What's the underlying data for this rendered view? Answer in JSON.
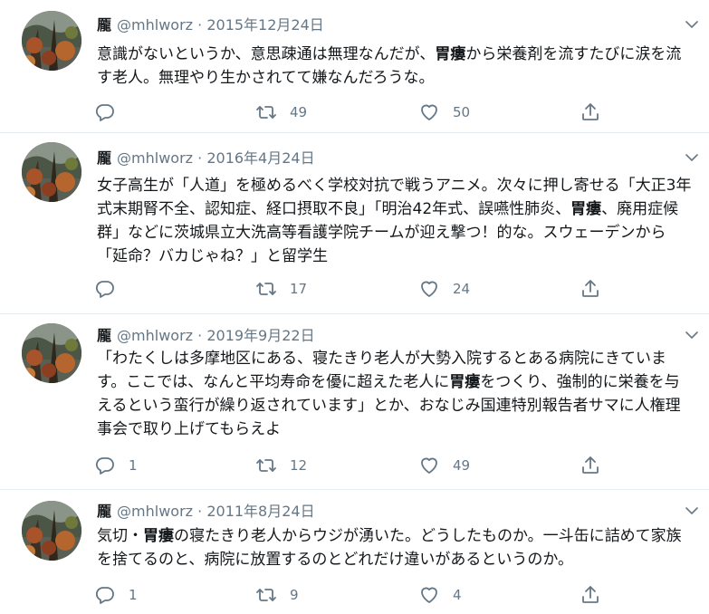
{
  "tweets": [
    {
      "name": "龎",
      "handle": "@mhlworz",
      "date": "2015年12月24日",
      "text_parts": [
        "意識がないというか、意思疎通は無理なんだが、",
        "胃瘻",
        "から栄養剤を流すたびに涙を流す老人。無理やり生かされてて嫌なんだろうな。"
      ],
      "replies": "",
      "retweets": "49",
      "likes": "50"
    },
    {
      "name": "龎",
      "handle": "@mhlworz",
      "date": "2016年4月24日",
      "text_parts": [
        "女子高生が「人道」を極めるべく学校対抗で戦うアニメ。次々に押し寄せる「大正3年式末期腎不全、認知症、経口摂取不良」「明治42年式、誤嚥性肺炎、",
        "胃瘻",
        "、廃用症候群」などに茨城県立大洗高等看護学院チームが迎え撃つ！的な。スウェーデンから「延命？バカじゃね？」と留学生"
      ],
      "replies": "",
      "retweets": "17",
      "likes": "24"
    },
    {
      "name": "龎",
      "handle": "@mhlworz",
      "date": "2019年9月22日",
      "text_parts": [
        "「わたくしは多摩地区にある、寝たきり老人が大勢入院するとある病院にきています。ここでは、なんと平均寿命を優に超えた老人に",
        "胃瘻",
        "をつくり、強制的に栄養を与えるという蛮行が繰り返されています」とか、おなじみ国連特別報告者サマに人権理事会で取り上げてもらえよ"
      ],
      "replies": "1",
      "retweets": "12",
      "likes": "49"
    },
    {
      "name": "龎",
      "handle": "@mhlworz",
      "date": "2011年8月24日",
      "text_parts": [
        "気切・",
        "胃瘻",
        "の寝たきり老人からウジが湧いた。どうしたものか。一斗缶に詰めて家族を捨てるのと、病院に放置するのとどれだけ違いがあるというのか。"
      ],
      "replies": "1",
      "retweets": "9",
      "likes": "4"
    }
  ],
  "separator": "·",
  "icons": {
    "reply": "reply-icon",
    "retweet": "retweet-icon",
    "like": "heart-icon",
    "share": "share-icon",
    "more": "chevron-down-icon"
  },
  "colors": {
    "meta": "#657786",
    "text": "#14171a",
    "border": "#e6ecf0"
  }
}
